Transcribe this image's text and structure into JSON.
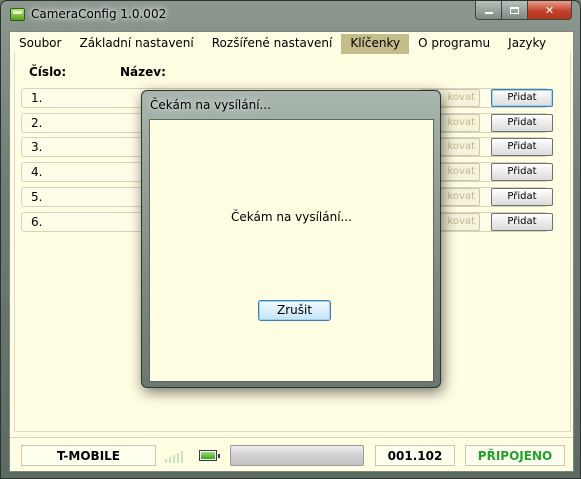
{
  "window": {
    "title": "CameraConfig 1.0.002"
  },
  "menu": [
    {
      "label": "Soubor",
      "active": false
    },
    {
      "label": "Základní nastavení",
      "active": false
    },
    {
      "label": "Rozšířené nastavení",
      "active": false
    },
    {
      "label": "Klíčenky",
      "active": true
    },
    {
      "label": "O programu",
      "active": false
    },
    {
      "label": "Jazyky",
      "active": false
    }
  ],
  "table": {
    "col_number": "Číslo:",
    "col_name": "Název:",
    "rows": [
      {
        "number": "1.",
        "edit_label": "kovat",
        "add_label": "Přidat"
      },
      {
        "number": "2.",
        "edit_label": "kovat",
        "add_label": "Přidat"
      },
      {
        "number": "3.",
        "edit_label": "kovat",
        "add_label": "Přidat"
      },
      {
        "number": "4.",
        "edit_label": "kovat",
        "add_label": "Přidat"
      },
      {
        "number": "5.",
        "edit_label": "kovat",
        "add_label": "Přidat"
      },
      {
        "number": "6.",
        "edit_label": "kovat",
        "add_label": "Přidat"
      }
    ]
  },
  "status": {
    "operator": "T-MOBILE",
    "version": "001.102",
    "connection": "PŘIPOJENO",
    "connection_color": "#21a32b",
    "progress": 0
  },
  "dialog": {
    "title": "Čekám na vysílání...",
    "message": "Čekám na vysílání...",
    "cancel_label": "Zrušit"
  }
}
